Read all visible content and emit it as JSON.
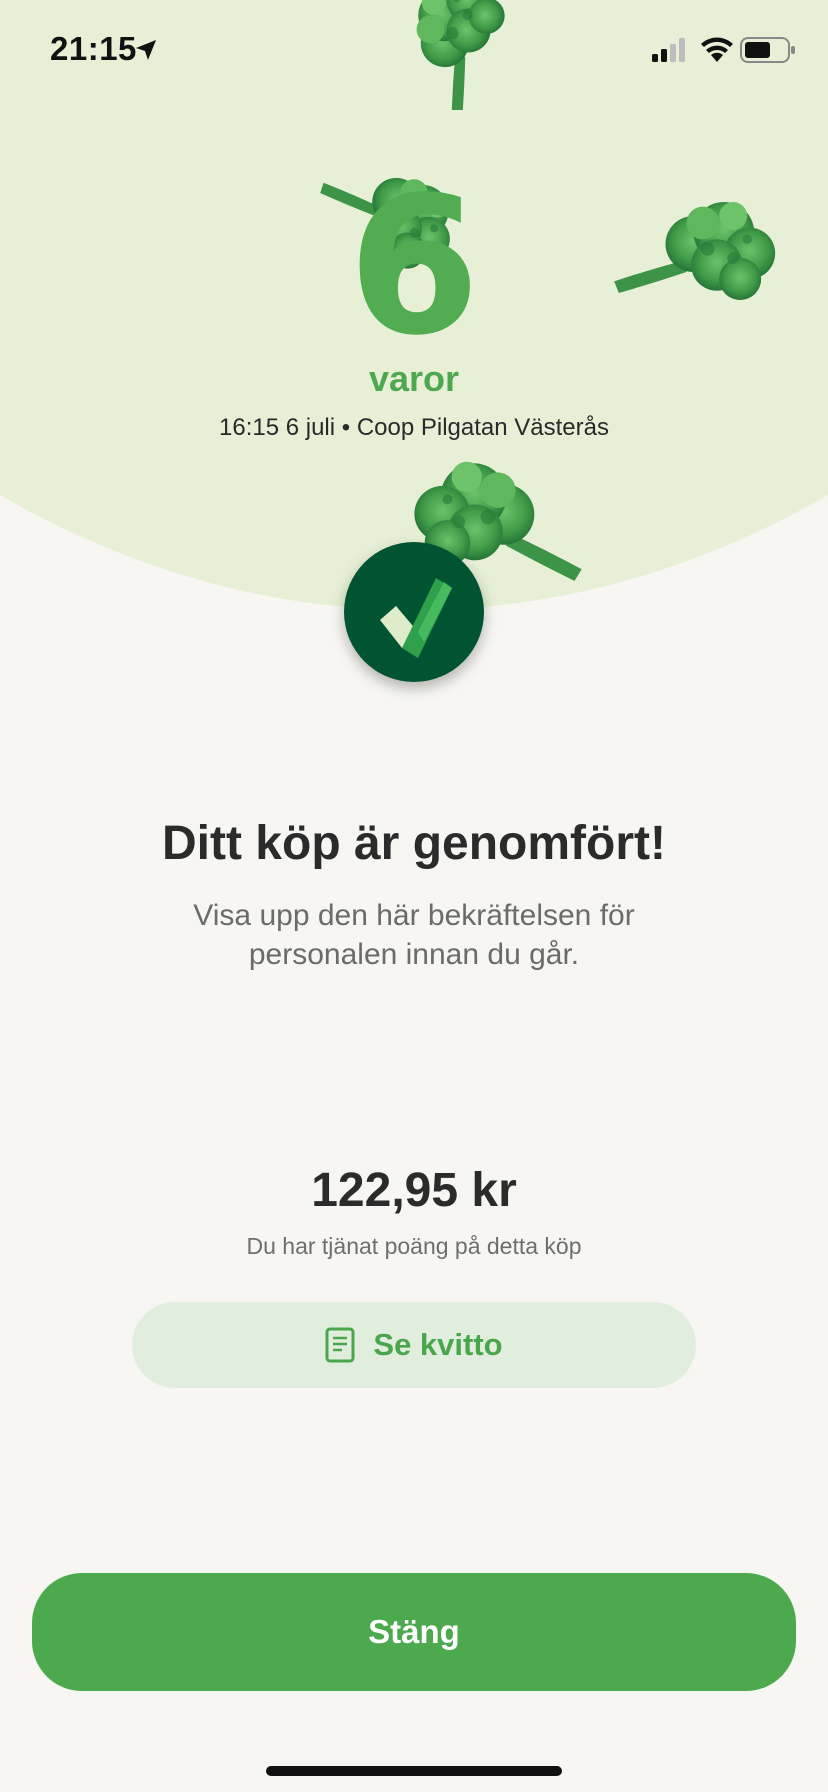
{
  "status_bar": {
    "time": "21:15",
    "icons": [
      "location-arrow-icon",
      "cellular-signal-icon",
      "wifi-icon",
      "battery-icon"
    ]
  },
  "hero": {
    "item_count": "6",
    "item_label": "varor",
    "meta": "16:15 6 juli • Coop Pilgatan Västerås",
    "badge_icon": "checkmark-icon"
  },
  "confirmation": {
    "title": "Ditt köp är genomfört!",
    "subtitle": "Visa upp den här bekräftelsen för personalen innan du går."
  },
  "summary": {
    "amount": "122,95 kr",
    "points_note": "Du har tjänat poäng på detta köp"
  },
  "actions": {
    "receipt_label": "Se kvitto",
    "receipt_icon": "receipt-icon",
    "close_label": "Stäng"
  },
  "colors": {
    "brand_green": "#4ca94e",
    "dark_green": "#005432",
    "hero_bg": "#e7f0d6",
    "page_bg": "#f7f6f2"
  }
}
